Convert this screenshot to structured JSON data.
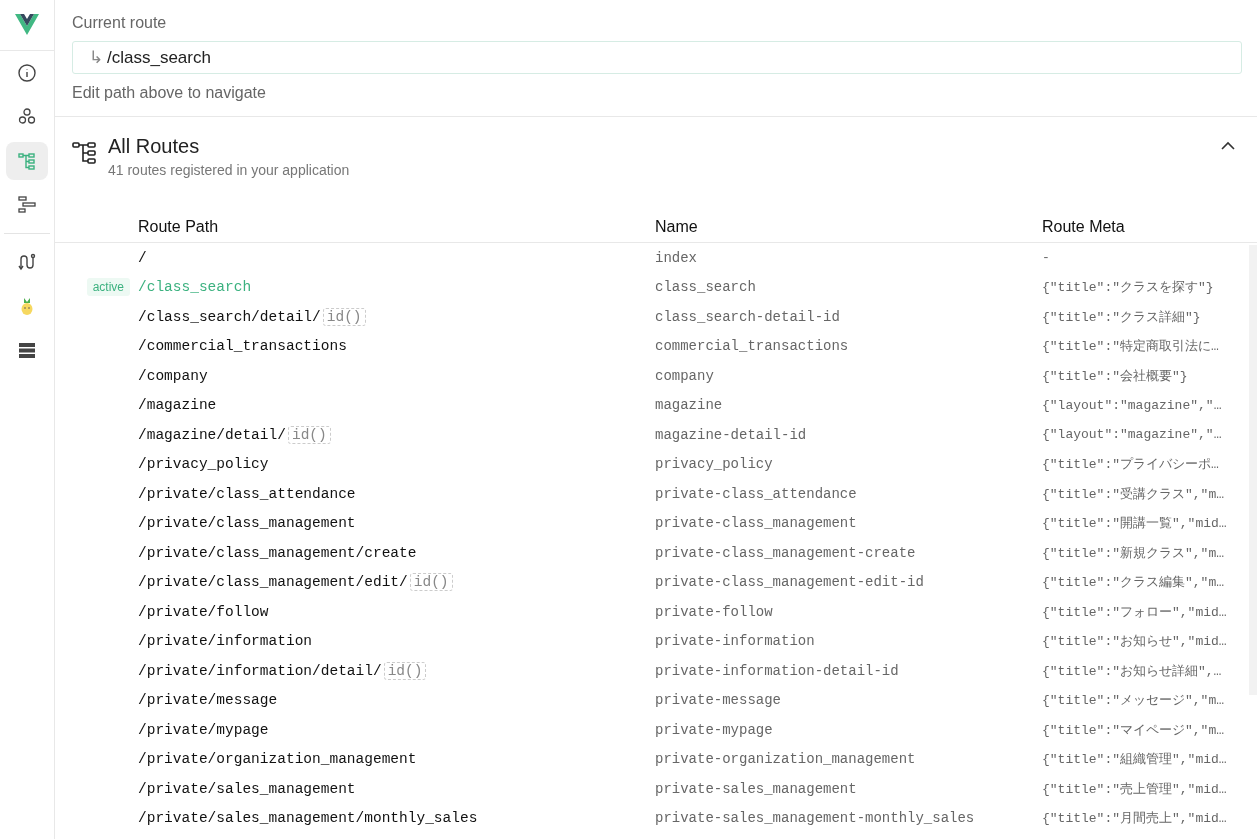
{
  "sidebar": {
    "items": [
      {
        "kind": "info",
        "selected": false
      },
      {
        "kind": "components",
        "selected": false
      },
      {
        "kind": "routes",
        "selected": true
      },
      {
        "kind": "timeline",
        "selected": false
      },
      {
        "kind": "router",
        "selected": false
      },
      {
        "kind": "pinia",
        "selected": false
      },
      {
        "kind": "storage",
        "selected": false
      }
    ]
  },
  "current_route": {
    "label": "Current route",
    "arrow": "↳",
    "value": "/class_search",
    "hint": "Edit path above to navigate"
  },
  "all_routes": {
    "title": "All Routes",
    "subtitle": "41 routes registered in your application",
    "expanded": true,
    "columns": [
      "Route Path",
      "Name",
      "Route Meta"
    ],
    "rows": [
      {
        "active": false,
        "path": "/",
        "name": "index",
        "meta": "-"
      },
      {
        "active": true,
        "badge": "active",
        "path": "/class_search",
        "name": "class_search",
        "meta": "{\"title\":\"クラスを探す\"}"
      },
      {
        "active": false,
        "path": [
          {
            "kind": "text",
            "text": "/class_search/detail/"
          },
          {
            "kind": "param",
            "text": "id()"
          }
        ],
        "name": "class_search-detail-id",
        "meta": "{\"title\":\"クラス詳細\"}"
      },
      {
        "active": false,
        "path": "/commercial_transactions",
        "name": "commercial_transactions",
        "meta": "{\"title\":\"特定商取引法に…"
      },
      {
        "active": false,
        "path": "/company",
        "name": "company",
        "meta": "{\"title\":\"会社概要\"}"
      },
      {
        "active": false,
        "path": "/magazine",
        "name": "magazine",
        "meta": "{\"layout\":\"magazine\",\"…"
      },
      {
        "active": false,
        "path": [
          {
            "kind": "text",
            "text": "/magazine/detail/"
          },
          {
            "kind": "param",
            "text": "id()"
          }
        ],
        "name": "magazine-detail-id",
        "meta": "{\"layout\":\"magazine\",\"…"
      },
      {
        "active": false,
        "path": "/privacy_policy",
        "name": "privacy_policy",
        "meta": "{\"title\":\"プライバシーポ…"
      },
      {
        "active": false,
        "path": "/private/class_attendance",
        "name": "private-class_attendance",
        "meta": "{\"title\":\"受講クラス\",\"m…"
      },
      {
        "active": false,
        "path": "/private/class_management",
        "name": "private-class_management",
        "meta": "{\"title\":\"開講一覧\",\"mid…"
      },
      {
        "active": false,
        "path": "/private/class_management/create",
        "name": "private-class_management-create",
        "meta": "{\"title\":\"新規クラス\",\"m…"
      },
      {
        "active": false,
        "path": [
          {
            "kind": "text",
            "text": "/private/class_management/edit/"
          },
          {
            "kind": "param",
            "text": "id()"
          }
        ],
        "name": "private-class_management-edit-id",
        "meta": "{\"title\":\"クラス編集\",\"m…"
      },
      {
        "active": false,
        "path": "/private/follow",
        "name": "private-follow",
        "meta": "{\"title\":\"フォロー\",\"mid…"
      },
      {
        "active": false,
        "path": "/private/information",
        "name": "private-information",
        "meta": "{\"title\":\"お知らせ\",\"mid…"
      },
      {
        "active": false,
        "path": [
          {
            "kind": "text",
            "text": "/private/information/detail/"
          },
          {
            "kind": "param",
            "text": "id()"
          }
        ],
        "name": "private-information-detail-id",
        "meta": "{\"title\":\"お知らせ詳細\",…"
      },
      {
        "active": false,
        "path": "/private/message",
        "name": "private-message",
        "meta": "{\"title\":\"メッセージ\",\"m…"
      },
      {
        "active": false,
        "path": "/private/mypage",
        "name": "private-mypage",
        "meta": "{\"title\":\"マイページ\",\"m…"
      },
      {
        "active": false,
        "path": "/private/organization_management",
        "name": "private-organization_management",
        "meta": "{\"title\":\"組織管理\",\"mid…"
      },
      {
        "active": false,
        "path": "/private/sales_management",
        "name": "private-sales_management",
        "meta": "{\"title\":\"売上管理\",\"mid…"
      },
      {
        "active": false,
        "path": "/private/sales_management/monthly_sales",
        "name": "private-sales_management-monthly_sales",
        "meta": "{\"title\":\"月間売上\",\"mid…"
      }
    ]
  }
}
